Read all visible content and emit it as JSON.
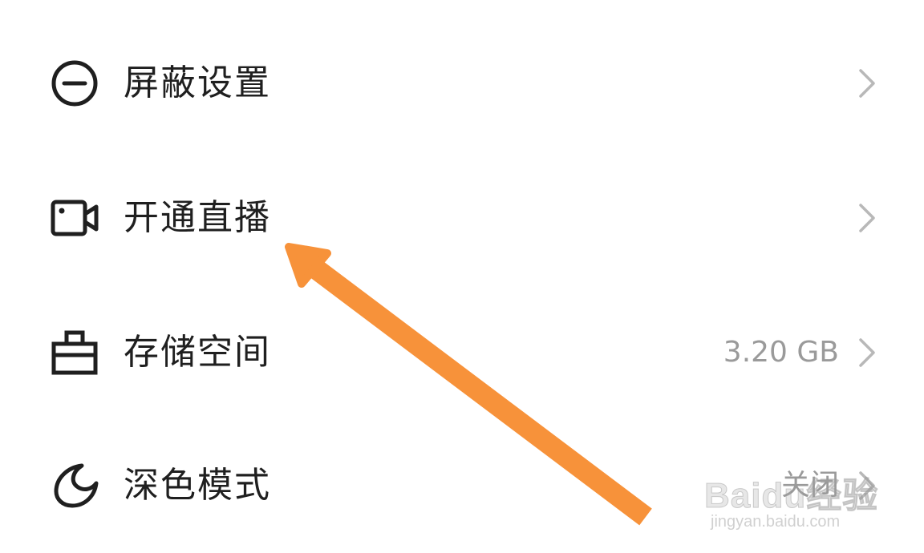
{
  "settings": {
    "items": [
      {
        "label": "屏蔽设置",
        "value": "",
        "icon": "block-icon"
      },
      {
        "label": "开通直播",
        "value": "",
        "icon": "video-camera-icon"
      },
      {
        "label": "存储空间",
        "value": "3.20 GB",
        "icon": "storage-box-icon"
      },
      {
        "label": "深色模式",
        "value": "关闭",
        "icon": "moon-icon"
      }
    ]
  },
  "colors": {
    "text": "#1f1f1f",
    "value_text": "#9a9a9a",
    "chevron": "#b8b8b8",
    "annotation_arrow": "#f7923a"
  },
  "watermark": {
    "brand": "Baidu经验",
    "url": "jingyan.baidu.com"
  }
}
